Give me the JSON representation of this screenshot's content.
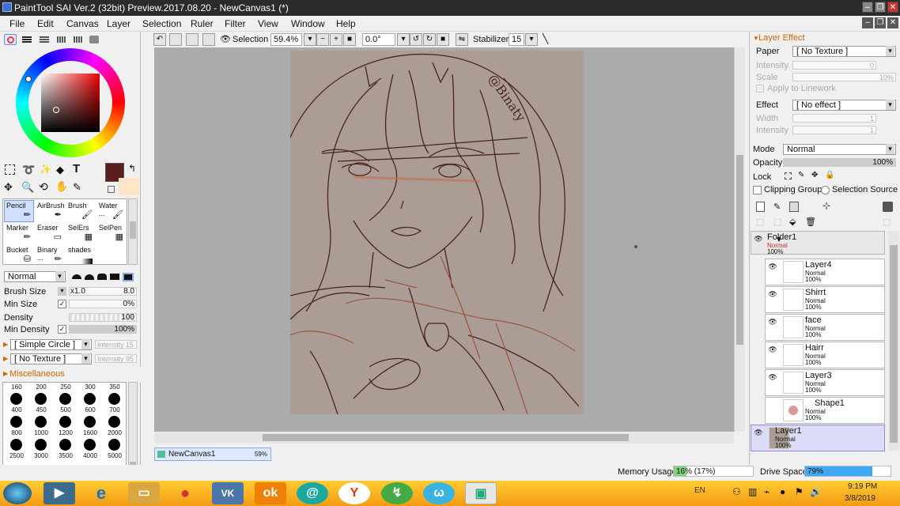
{
  "window": {
    "title": "PaintTool SAI Ver.2 (32bit) Preview.2017.08.20 - NewCanvas1 (*)"
  },
  "menu": [
    "File",
    "Edit",
    "Canvas",
    "Layer",
    "Selection",
    "Ruler",
    "Filter",
    "View",
    "Window",
    "Help"
  ],
  "toolbar": {
    "selection_label": "Selection",
    "zoom": "59.4%",
    "rotation": "0.0°",
    "stabilizer_label": "Stabilizer",
    "stabilizer_value": "15"
  },
  "tools": {
    "row1": [
      "Pencil",
      "AirBrush",
      "Brush",
      "Water ..."
    ],
    "row2": [
      "Marker",
      "Eraser",
      "SelErs",
      "SelPen"
    ],
    "row3": [
      "Bucket",
      "Binary ...",
      "shades"
    ]
  },
  "brush": {
    "blend_mode": "Normal",
    "size_label": "Brush Size",
    "size_mult": "x1.0",
    "size_value": "8.0",
    "min_size_label": "Min Size",
    "min_size_value": "0%",
    "density_label": "Density",
    "density_value": "100",
    "min_density_label": "Min Density",
    "min_density_value": "100%",
    "shape": "[ Simple Circle ]",
    "shape_intensity": "Intensity 15",
    "texture": "[ No Texture ]",
    "texture_intensity": "Intensity 95",
    "misc_label": "Miscellaneous"
  },
  "brush_sizes": {
    "top_labels": [
      "160",
      "200",
      "250",
      "300",
      "350"
    ],
    "rows": [
      [
        "400",
        "450",
        "500",
        "600",
        "700"
      ],
      [
        "800",
        "1000",
        "1200",
        "1600",
        "2000"
      ],
      [
        "2500",
        "3000",
        "3500",
        "4000",
        "5000"
      ]
    ]
  },
  "colors": {
    "primary": "#5a1e1e",
    "secondary": "#fde6c8",
    "paper": "#ab9d96",
    "canvas_bg": "#ababab",
    "selected_layer": "#dcdcf8",
    "accent": "#3a6fd8"
  },
  "canvas": {
    "watermark": "@Binaty"
  },
  "doc_tab": {
    "name": "NewCanvas1",
    "zoom": "59%"
  },
  "layer_effect": {
    "header": "Layer Effect",
    "paper_label": "Paper",
    "paper_value": "[ No Texture ]",
    "intensity_label": "Intensity",
    "intensity_value": "0",
    "scale_label": "Scale",
    "scale_value": "10%",
    "apply_label": "Apply to Linework",
    "effect_label": "Effect",
    "effect_value": "[ No effect ]",
    "width_label": "Width",
    "width_value": "1",
    "intensity2_label": "Intensity",
    "intensity2_value": "1"
  },
  "layer_props": {
    "mode_label": "Mode",
    "mode_value": "Normal",
    "opacity_label": "Opacity",
    "opacity_value": "100%",
    "lock_label": "Lock",
    "clipping_label": "Clipping Group",
    "selection_source_label": "Selection Source"
  },
  "layers": [
    {
      "name": "Folder1",
      "mode": "Normal",
      "opacity": "100%"
    },
    {
      "name": "Layer4",
      "mode": "Normal",
      "opacity": "100%"
    },
    {
      "name": "Shirrt",
      "mode": "Normal",
      "opacity": "100%"
    },
    {
      "name": "face",
      "mode": "Normal",
      "opacity": "100%"
    },
    {
      "name": "Hairr",
      "mode": "Normal",
      "opacity": "100%"
    },
    {
      "name": "Layer3",
      "mode": "Normal",
      "opacity": "100%"
    },
    {
      "name": "Shape1",
      "mode": "Normal",
      "opacity": "100%"
    },
    {
      "name": "Layer1",
      "mode": "Normal",
      "opacity": "100%"
    }
  ],
  "status": {
    "memory_label": "Memory Usage",
    "memory_value": "16% (17%)",
    "memory_fraction": 0.16,
    "drive_label": "Drive Space",
    "drive_value": "79%",
    "drive_fraction": 0.79
  },
  "taskbar": {
    "lang": "EN",
    "time": "9:19 PM",
    "date": "3/8/2019"
  }
}
